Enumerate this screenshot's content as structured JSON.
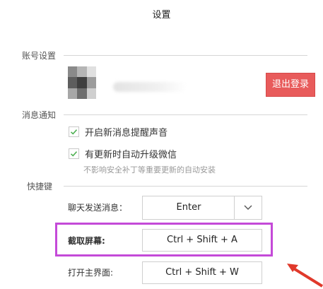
{
  "window": {
    "title": "设置"
  },
  "account": {
    "section_label": "账号设置",
    "logout_label": "退出登录"
  },
  "notify": {
    "section_label": "消息通知",
    "options": [
      {
        "label": "开启新消息提醒声音",
        "checked": true
      },
      {
        "label": "有更新时自动升级微信",
        "checked": true
      }
    ],
    "update_note": "不影响安全补丁等重要更新的自动安装"
  },
  "shortcuts": {
    "section_label": "快捷键",
    "send": {
      "label": "聊天发送消息：",
      "value": "Enter"
    },
    "screenshot": {
      "label": "截取屏幕:",
      "value": "Ctrl + Shift + A"
    },
    "open_main": {
      "label": "打开主界面:",
      "value": "Ctrl + Shift + W"
    }
  },
  "colors": {
    "highlight": "#c44ad8",
    "arrow": "#e0392b",
    "logout_bg": "#e85b5b",
    "check": "#4caf50"
  }
}
